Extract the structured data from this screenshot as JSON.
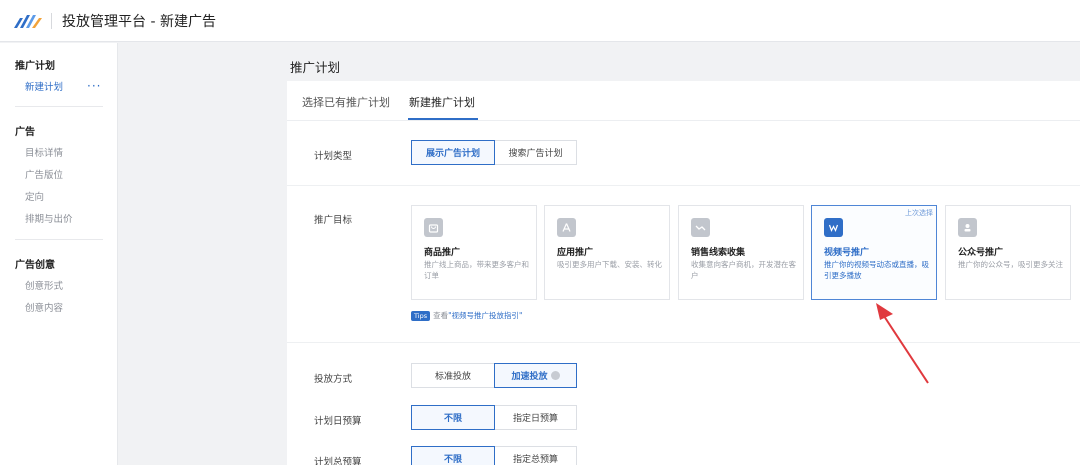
{
  "header": {
    "title": "投放管理平台 - 新建广告"
  },
  "sidebar": {
    "plan_head": "推广计划",
    "new_plan": "新建计划",
    "more": "···",
    "ad_head": "广告",
    "ad_items": [
      "目标详情",
      "广告版位",
      "定向",
      "排期与出价"
    ],
    "creative_head": "广告创意",
    "creative_items": [
      "创意形式",
      "创意内容"
    ]
  },
  "main": {
    "title": "推广计划",
    "tabs": [
      {
        "label": "选择已有推广计划",
        "active": false
      },
      {
        "label": "新建推广计划",
        "active": true
      }
    ],
    "plan_type": {
      "label": "计划类型",
      "options": [
        "展示广告计划",
        "搜索广告计划"
      ],
      "selected": "展示广告计划"
    },
    "goal": {
      "label": "推广目标",
      "cards": [
        {
          "title": "商品推广",
          "desc": "推广线上商品，带来更多客户和订单",
          "icon": "shopping-bag-icon"
        },
        {
          "title": "应用推广",
          "desc": "吸引更多用户下载、安装、转化",
          "icon": "app-store-icon"
        },
        {
          "title": "销售线索收集",
          "desc": "收集意向客户商机，开发潜在客户",
          "icon": "chart-trend-icon"
        },
        {
          "title": "视频号推广",
          "desc": "推广你的视频号动态或直播，吸引更多播放",
          "icon": "video-channel-icon",
          "badge": "上次选择",
          "selected": true
        },
        {
          "title": "公众号推广",
          "desc": "推广你的公众号，吸引更多关注",
          "icon": "account-icon"
        }
      ],
      "tips_badge": "Tips",
      "tips_text": "查看",
      "tips_link": "\"视频号推广投放指引\""
    },
    "delivery": {
      "label": "投放方式",
      "options": [
        "标准投放",
        "加速投放"
      ],
      "selected": "加速投放"
    },
    "daily_budget": {
      "label": "计划日预算",
      "options": [
        "不限",
        "指定日预算"
      ],
      "selected": "不限"
    },
    "total_budget": {
      "label": "计划总预算",
      "options": [
        "不限",
        "指定总预算"
      ],
      "selected": "不限"
    }
  },
  "colors": {
    "accent": "#2f6ec7",
    "annotation_arrow": "#e0393e"
  }
}
